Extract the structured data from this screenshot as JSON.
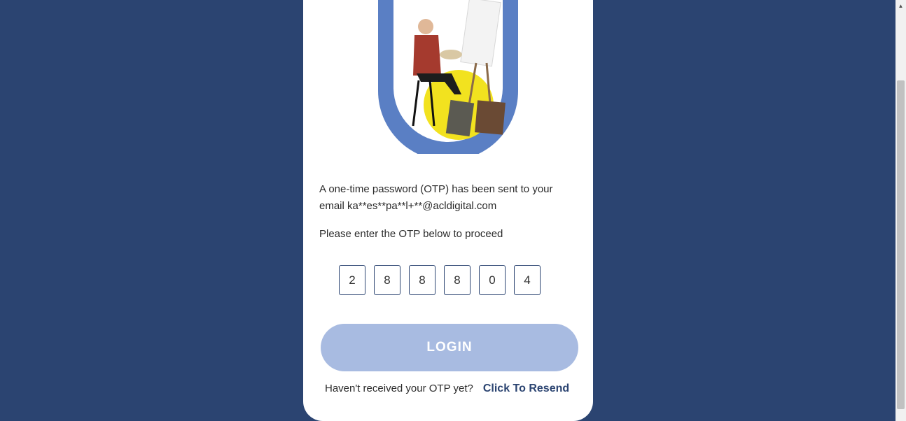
{
  "otp_message": "A one-time password (OTP) has been sent to your email ka**es**pa**l+**@acldigital.com",
  "instruction": "Please enter the OTP below to proceed",
  "otp_digits": [
    "2",
    "8",
    "8",
    "8",
    "0",
    "4"
  ],
  "login_label": "LOGIN",
  "resend_prompt": "Haven't received your OTP yet?",
  "resend_link": "Click To Resend",
  "scroll_up_glyph": "▲",
  "colors": {
    "background": "#2b4471",
    "card": "#ffffff",
    "login_button": "#a8bbe1",
    "hero_arch": "#5a7fc4",
    "hero_sun": "#f2e21f"
  }
}
